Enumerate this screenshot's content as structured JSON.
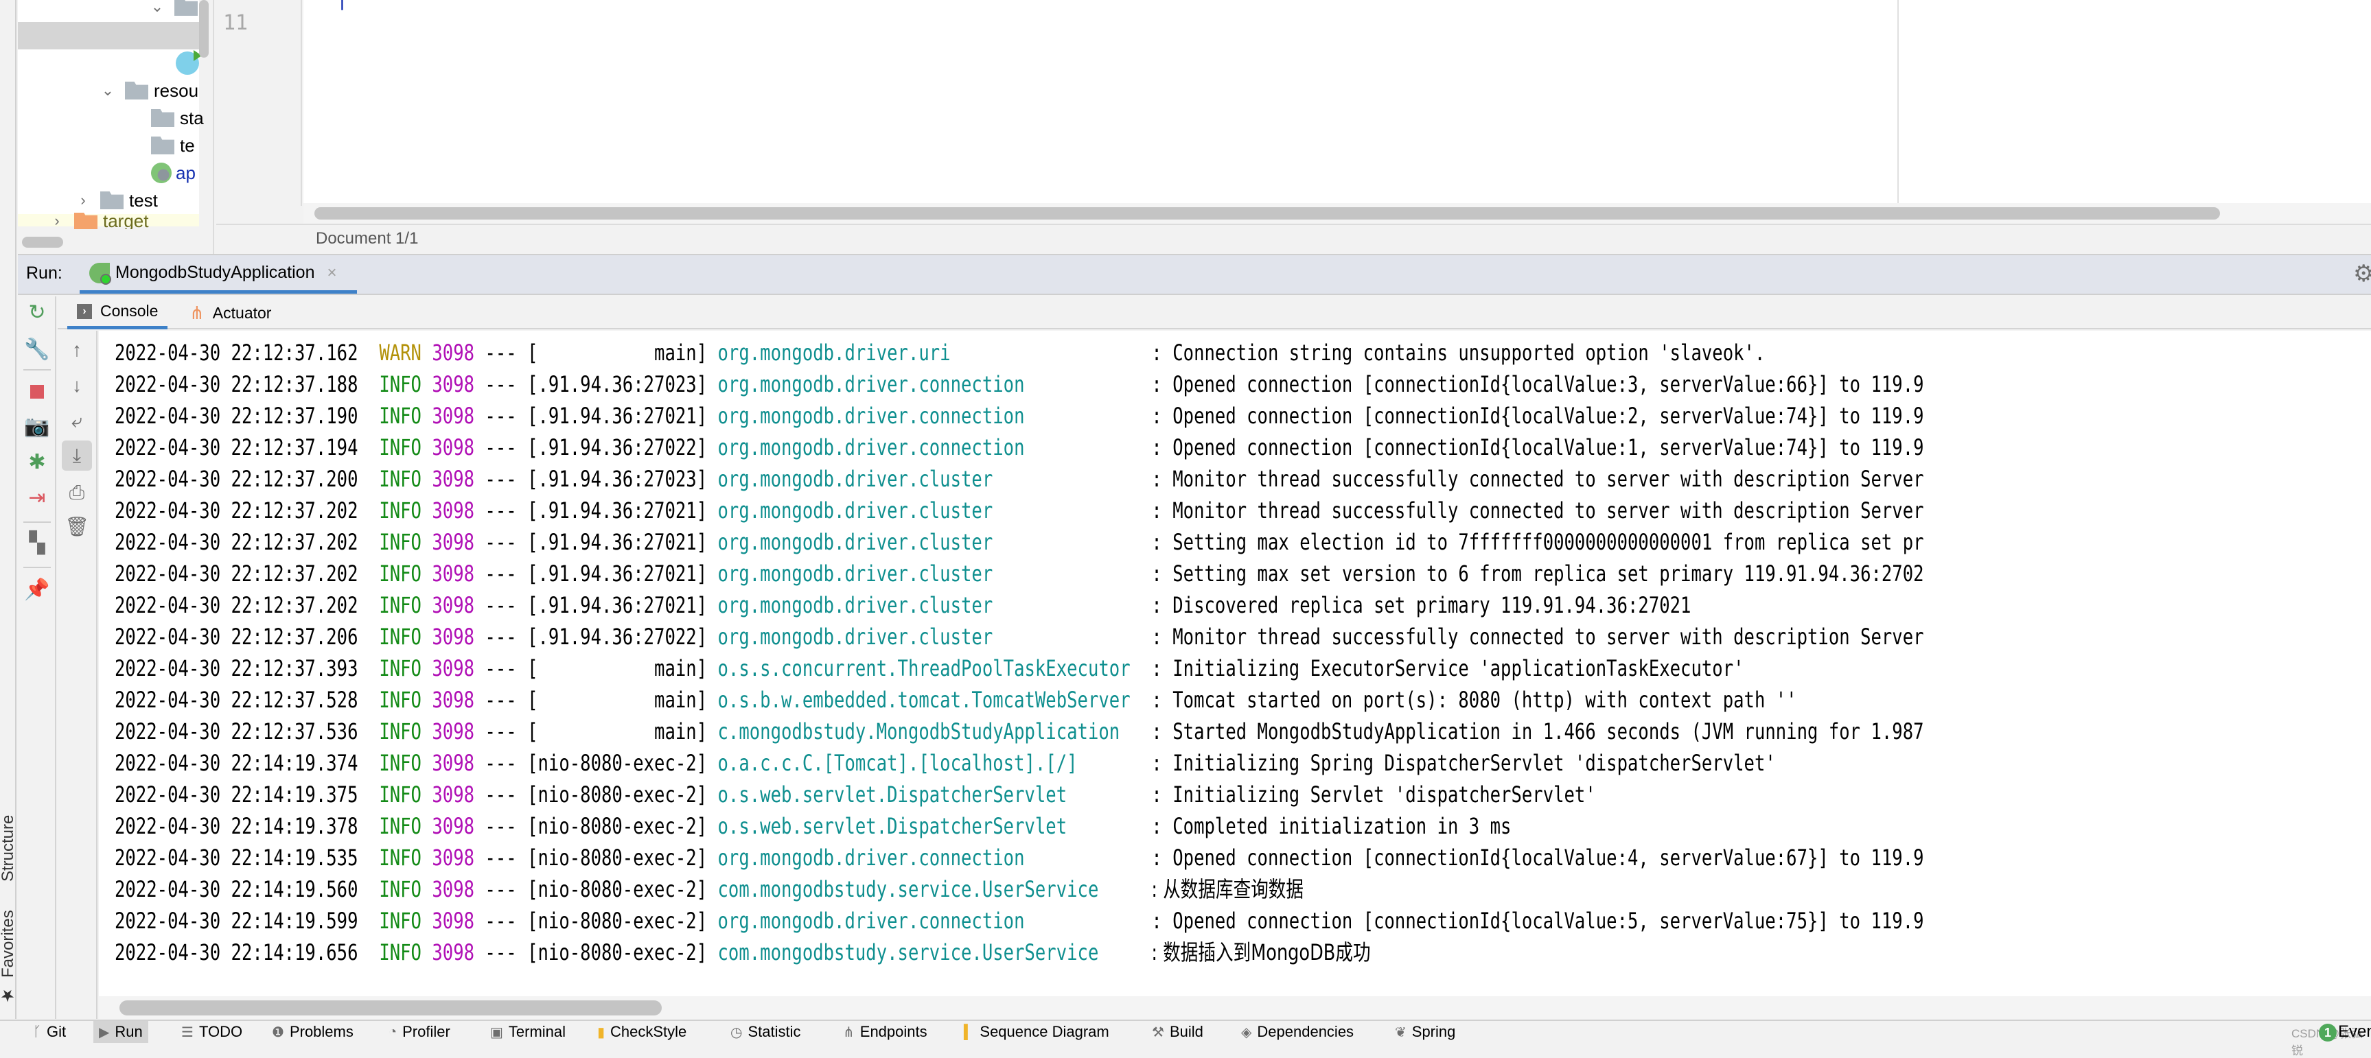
{
  "project_tree": {
    "items": [
      {
        "label": "",
        "type": "package",
        "expanded": true
      },
      {
        "label": "",
        "type": "selected-row"
      },
      {
        "label": "",
        "type": "spring-boot-class"
      },
      {
        "label": "resou",
        "type": "resources-folder",
        "expanded": true
      },
      {
        "label": "sta",
        "type": "folder"
      },
      {
        "label": "te",
        "type": "folder"
      },
      {
        "label": "ap",
        "type": "spring-config-file"
      },
      {
        "label": "test",
        "type": "folder",
        "expanded": false
      },
      {
        "label": "target",
        "type": "excluded-folder",
        "expanded": false
      }
    ]
  },
  "editor": {
    "line_number": "11",
    "status": "Document 1/1"
  },
  "run_panel": {
    "label": "Run:",
    "tab_label": "MongodbStudyApplication",
    "close_icon": "×",
    "tabs": [
      {
        "label": "Console",
        "active": true
      },
      {
        "label": "Actuator",
        "active": false
      }
    ]
  },
  "left_tool_windows": {
    "structure": "Structure",
    "favorites": "Favorites"
  },
  "log": [
    {
      "date": "2022-04-30 22:12:37.162",
      "level": "WARN",
      "pid": "3098",
      "sep": "---",
      "thread": "[           main]",
      "logger": "org.mongodb.driver.uri",
      "message": ": Connection string contains unsupported option 'slaveok'."
    },
    {
      "date": "2022-04-30 22:12:37.188",
      "level": "INFO",
      "pid": "3098",
      "sep": "---",
      "thread": "[.91.94.36:27023]",
      "logger": "org.mongodb.driver.connection",
      "message": ": Opened connection [connectionId{localValue:3, serverValue:66}] to 119.9"
    },
    {
      "date": "2022-04-30 22:12:37.190",
      "level": "INFO",
      "pid": "3098",
      "sep": "---",
      "thread": "[.91.94.36:27021]",
      "logger": "org.mongodb.driver.connection",
      "message": ": Opened connection [connectionId{localValue:2, serverValue:74}] to 119.9"
    },
    {
      "date": "2022-04-30 22:12:37.194",
      "level": "INFO",
      "pid": "3098",
      "sep": "---",
      "thread": "[.91.94.36:27022]",
      "logger": "org.mongodb.driver.connection",
      "message": ": Opened connection [connectionId{localValue:1, serverValue:74}] to 119.9"
    },
    {
      "date": "2022-04-30 22:12:37.200",
      "level": "INFO",
      "pid": "3098",
      "sep": "---",
      "thread": "[.91.94.36:27023]",
      "logger": "org.mongodb.driver.cluster",
      "message": ": Monitor thread successfully connected to server with description Server"
    },
    {
      "date": "2022-04-30 22:12:37.202",
      "level": "INFO",
      "pid": "3098",
      "sep": "---",
      "thread": "[.91.94.36:27021]",
      "logger": "org.mongodb.driver.cluster",
      "message": ": Monitor thread successfully connected to server with description Server"
    },
    {
      "date": "2022-04-30 22:12:37.202",
      "level": "INFO",
      "pid": "3098",
      "sep": "---",
      "thread": "[.91.94.36:27021]",
      "logger": "org.mongodb.driver.cluster",
      "message": ": Setting max election id to 7fffffff0000000000000001 from replica set pr"
    },
    {
      "date": "2022-04-30 22:12:37.202",
      "level": "INFO",
      "pid": "3098",
      "sep": "---",
      "thread": "[.91.94.36:27021]",
      "logger": "org.mongodb.driver.cluster",
      "message": ": Setting max set version to 6 from replica set primary 119.91.94.36:2702"
    },
    {
      "date": "2022-04-30 22:12:37.202",
      "level": "INFO",
      "pid": "3098",
      "sep": "---",
      "thread": "[.91.94.36:27021]",
      "logger": "org.mongodb.driver.cluster",
      "message": ": Discovered replica set primary 119.91.94.36:27021"
    },
    {
      "date": "2022-04-30 22:12:37.206",
      "level": "INFO",
      "pid": "3098",
      "sep": "---",
      "thread": "[.91.94.36:27022]",
      "logger": "org.mongodb.driver.cluster",
      "message": ": Monitor thread successfully connected to server with description Server"
    },
    {
      "date": "2022-04-30 22:12:37.393",
      "level": "INFO",
      "pid": "3098",
      "sep": "---",
      "thread": "[           main]",
      "logger": "o.s.s.concurrent.ThreadPoolTaskExecutor",
      "message": ": Initializing ExecutorService 'applicationTaskExecutor'"
    },
    {
      "date": "2022-04-30 22:12:37.528",
      "level": "INFO",
      "pid": "3098",
      "sep": "---",
      "thread": "[           main]",
      "logger": "o.s.b.w.embedded.tomcat.TomcatWebServer",
      "message": ": Tomcat started on port(s): 8080 (http) with context path ''"
    },
    {
      "date": "2022-04-30 22:12:37.536",
      "level": "INFO",
      "pid": "3098",
      "sep": "---",
      "thread": "[           main]",
      "logger": "c.mongodbstudy.MongodbStudyApplication",
      "message": ": Started MongodbStudyApplication in 1.466 seconds (JVM running for 1.987"
    },
    {
      "date": "2022-04-30 22:14:19.374",
      "level": "INFO",
      "pid": "3098",
      "sep": "---",
      "thread": "[nio-8080-exec-2]",
      "logger": "o.a.c.c.C.[Tomcat].[localhost].[/]",
      "message": ": Initializing Spring DispatcherServlet 'dispatcherServlet'"
    },
    {
      "date": "2022-04-30 22:14:19.375",
      "level": "INFO",
      "pid": "3098",
      "sep": "---",
      "thread": "[nio-8080-exec-2]",
      "logger": "o.s.web.servlet.DispatcherServlet",
      "message": ": Initializing Servlet 'dispatcherServlet'"
    },
    {
      "date": "2022-04-30 22:14:19.378",
      "level": "INFO",
      "pid": "3098",
      "sep": "---",
      "thread": "[nio-8080-exec-2]",
      "logger": "o.s.web.servlet.DispatcherServlet",
      "message": ": Completed initialization in 3 ms"
    },
    {
      "date": "2022-04-30 22:14:19.535",
      "level": "INFO",
      "pid": "3098",
      "sep": "---",
      "thread": "[nio-8080-exec-2]",
      "logger": "org.mongodb.driver.connection",
      "message": ": Opened connection [connectionId{localValue:4, serverValue:67}] to 119.9"
    },
    {
      "date": "2022-04-30 22:14:19.560",
      "level": "INFO",
      "pid": "3098",
      "sep": "---",
      "thread": "[nio-8080-exec-2]",
      "logger": "com.mongodbstudy.service.UserService",
      "message": ": 从数据库查询数据"
    },
    {
      "date": "2022-04-30 22:14:19.599",
      "level": "INFO",
      "pid": "3098",
      "sep": "---",
      "thread": "[nio-8080-exec-2]",
      "logger": "org.mongodb.driver.connection",
      "message": ": Opened connection [connectionId{localValue:5, serverValue:75}] to 119.9"
    },
    {
      "date": "2022-04-30 22:14:19.656",
      "level": "INFO",
      "pid": "3098",
      "sep": "---",
      "thread": "[nio-8080-exec-2]",
      "logger": "com.mongodbstudy.service.UserService",
      "message": ": 数据插入到MongoDB成功"
    }
  ],
  "bottom_bar": {
    "items": [
      {
        "label": "Git",
        "icon": "git-branch-icon",
        "glyph": "ᚴ"
      },
      {
        "label": "Run",
        "icon": "run-icon",
        "glyph": "▶",
        "active": true
      },
      {
        "label": "TODO",
        "icon": "todo-list-icon",
        "glyph": "☰"
      },
      {
        "label": "Problems",
        "icon": "problems-icon",
        "glyph": "❶"
      },
      {
        "label": "Profiler",
        "icon": "profiler-icon",
        "glyph": "◔"
      },
      {
        "label": "Terminal",
        "icon": "terminal-icon",
        "glyph": "▣"
      },
      {
        "label": "CheckStyle",
        "icon": "checkstyle-icon",
        "glyph": "▮"
      },
      {
        "label": "Statistic",
        "icon": "statistic-icon",
        "glyph": "◷"
      },
      {
        "label": "Endpoints",
        "icon": "endpoints-icon",
        "glyph": "⋔"
      },
      {
        "label": "Sequence Diagram",
        "icon": "sequence-diagram-icon",
        "glyph": "▍"
      },
      {
        "label": "Build",
        "icon": "build-hammer-icon",
        "glyph": "⚒"
      },
      {
        "label": "Dependencies",
        "icon": "dependencies-icon",
        "glyph": "◈"
      },
      {
        "label": "Spring",
        "icon": "spring-leaf-icon",
        "glyph": "❦"
      }
    ],
    "event_count": "1",
    "event_label": "Event",
    "watermark": "CSDN @张弘锐"
  },
  "colors": {
    "warn": "#b39108",
    "info": "#138a16",
    "pid": "#b00fb5",
    "logger": "#0f8f8f",
    "accent": "#3e81c8"
  }
}
